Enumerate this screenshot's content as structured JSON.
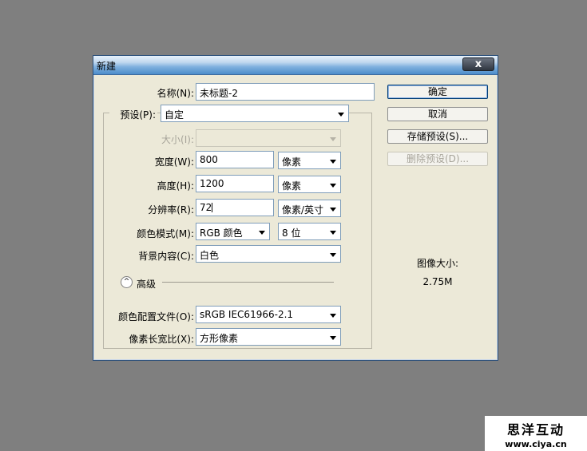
{
  "dialog": {
    "title": "新建",
    "close_label": "x"
  },
  "form": {
    "name_label": "名称(N):",
    "name_value": "未标题-2",
    "preset_label": "预设(P):",
    "preset_value": "自定",
    "size_label": "大小(I):",
    "size_value": "",
    "width_label": "宽度(W):",
    "width_value": "800",
    "width_unit": "像素",
    "height_label": "高度(H):",
    "height_value": "1200",
    "height_unit": "像素",
    "resolution_label": "分辨率(R):",
    "resolution_value": "72",
    "resolution_unit": "像素/英寸",
    "color_mode_label": "颜色模式(M):",
    "color_mode_value": "RGB 颜色",
    "bit_depth_value": "8 位",
    "background_label": "背景内容(C):",
    "background_value": "白色",
    "advanced_label": "高级",
    "color_profile_label": "颜色配置文件(O):",
    "color_profile_value": "sRGB IEC61966-2.1",
    "pixel_aspect_label": "像素长宽比(X):",
    "pixel_aspect_value": "方形像素"
  },
  "buttons": {
    "ok": "确定",
    "cancel": "取消",
    "save_preset": "存储预设(S)...",
    "delete_preset": "删除预设(D)..."
  },
  "image_size": {
    "label": "图像大小:",
    "value": "2.75M"
  },
  "watermark": {
    "title": "思洋互动",
    "url": "www.ciya.cn"
  },
  "colors": {
    "background": "#7f7f7f",
    "dialog": "#ece9d8",
    "titlebar_accent": "#4c8ccb"
  }
}
